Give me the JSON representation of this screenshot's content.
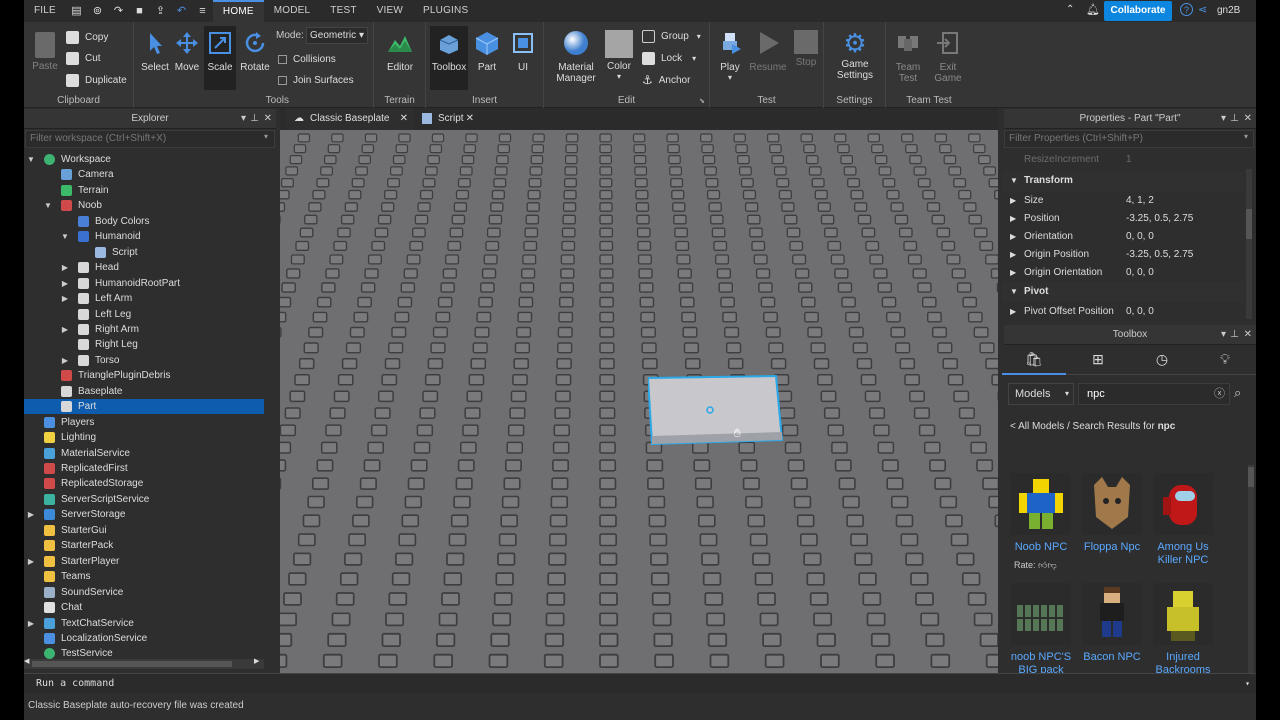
{
  "menu": {
    "file": "FILE",
    "tabs": [
      "HOME",
      "MODEL",
      "TEST",
      "VIEW",
      "PLUGINS"
    ],
    "collaborate": "Collaborate",
    "user": "gn2B"
  },
  "ribbon": {
    "clipboard": {
      "label": "Clipboard",
      "paste": "Paste",
      "copy": "Copy",
      "cut": "Cut",
      "duplicate": "Duplicate"
    },
    "tools": {
      "label": "Tools",
      "select": "Select",
      "move": "Move",
      "scale": "Scale",
      "rotate": "Rotate",
      "mode_label": "Mode:",
      "mode_value": "Geometric",
      "collisions": "Collisions",
      "join_surfaces": "Join Surfaces"
    },
    "terrain": {
      "label": "Terrain",
      "editor": "Editor"
    },
    "insert": {
      "label": "Insert",
      "toolbox": "Toolbox",
      "part": "Part",
      "ui": "UI"
    },
    "edit": {
      "label": "Edit",
      "material": "Material",
      "manager": "Manager",
      "color": "Color",
      "group": "Group",
      "lock": "Lock",
      "anchor": "Anchor"
    },
    "test": {
      "label": "Test",
      "play": "Play",
      "resume": "Resume",
      "stop": "Stop"
    },
    "settings": {
      "label": "Settings",
      "game": "Game",
      "settings": "Settings"
    },
    "team_test": {
      "label": "Team Test",
      "team": "Team",
      "test": "Test",
      "exit": "Exit",
      "game": "Game"
    }
  },
  "explorer": {
    "title": "Explorer",
    "filter_placeholder": "Filter workspace (Ctrl+Shift+X)",
    "items": [
      {
        "label": "Workspace",
        "indent": 0,
        "arrow": "▼",
        "color": "#3cb371",
        "round": true
      },
      {
        "label": "Camera",
        "indent": 1,
        "arrow": "",
        "color": "#6aa0d8"
      },
      {
        "label": "Terrain",
        "indent": 1,
        "arrow": "",
        "color": "#3cba6a"
      },
      {
        "label": "Noob",
        "indent": 1,
        "arrow": "▼",
        "color": "#d04a4a"
      },
      {
        "label": "Body Colors",
        "indent": 2,
        "arrow": "",
        "color": "#4a7fd8"
      },
      {
        "label": "Humanoid",
        "indent": 2,
        "arrow": "▼",
        "color": "#3b6fd0"
      },
      {
        "label": "Script",
        "indent": 3,
        "arrow": "",
        "color": "#9ab8e0"
      },
      {
        "label": "Head",
        "indent": 2,
        "arrow": "▶",
        "color": "#d8d8d8"
      },
      {
        "label": "HumanoidRootPart",
        "indent": 2,
        "arrow": "▶",
        "color": "#d8d8d8"
      },
      {
        "label": "Left Arm",
        "indent": 2,
        "arrow": "▶",
        "color": "#d8d8d8"
      },
      {
        "label": "Left Leg",
        "indent": 2,
        "arrow": "",
        "color": "#d8d8d8"
      },
      {
        "label": "Right Arm",
        "indent": 2,
        "arrow": "▶",
        "color": "#d8d8d8"
      },
      {
        "label": "Right Leg",
        "indent": 2,
        "arrow": "",
        "color": "#d8d8d8"
      },
      {
        "label": "Torso",
        "indent": 2,
        "arrow": "▶",
        "color": "#d8d8d8"
      },
      {
        "label": "TrianglePluginDebris",
        "indent": 1,
        "arrow": "",
        "color": "#d04a4a"
      },
      {
        "label": "Baseplate",
        "indent": 1,
        "arrow": "",
        "color": "#d8d8d8"
      },
      {
        "label": "Part",
        "indent": 1,
        "arrow": "",
        "color": "#d8d8d8",
        "selected": true
      },
      {
        "label": "Players",
        "indent": 0,
        "arrow": "",
        "color": "#4a8fe0"
      },
      {
        "label": "Lighting",
        "indent": 0,
        "arrow": "",
        "color": "#f0d040"
      },
      {
        "label": "MaterialService",
        "indent": 0,
        "arrow": "",
        "color": "#4aa0d8"
      },
      {
        "label": "ReplicatedFirst",
        "indent": 0,
        "arrow": "",
        "color": "#d04a4a"
      },
      {
        "label": "ReplicatedStorage",
        "indent": 0,
        "arrow": "",
        "color": "#d04a4a"
      },
      {
        "label": "ServerScriptService",
        "indent": 0,
        "arrow": "",
        "color": "#3cb3a0"
      },
      {
        "label": "ServerStorage",
        "indent": 0,
        "arrow": "▶",
        "color": "#3c8ad8"
      },
      {
        "label": "StarterGui",
        "indent": 0,
        "arrow": "",
        "color": "#f0c040"
      },
      {
        "label": "StarterPack",
        "indent": 0,
        "arrow": "",
        "color": "#f0c040"
      },
      {
        "label": "StarterPlayer",
        "indent": 0,
        "arrow": "▶",
        "color": "#f0c040"
      },
      {
        "label": "Teams",
        "indent": 0,
        "arrow": "",
        "color": "#f0c040"
      },
      {
        "label": "SoundService",
        "indent": 0,
        "arrow": "",
        "color": "#9ab0c8"
      },
      {
        "label": "Chat",
        "indent": 0,
        "arrow": "",
        "color": "#e0e0e0"
      },
      {
        "label": "TextChatService",
        "indent": 0,
        "arrow": "▶",
        "color": "#4aa0d8"
      },
      {
        "label": "LocalizationService",
        "indent": 0,
        "arrow": "",
        "color": "#4a8fe0"
      },
      {
        "label": "TestService",
        "indent": 0,
        "arrow": "",
        "color": "#3cb371",
        "round": true
      }
    ]
  },
  "doc_tabs": [
    "Classic Baseplate",
    "Script"
  ],
  "properties": {
    "title": "Properties - Part \"Part\"",
    "filter_placeholder": "Filter Properties (Ctrl+Shift+P)",
    "faded_row": "ResizeIncrement",
    "faded_value": "1",
    "sections": [
      {
        "name": "Transform",
        "rows": [
          {
            "name": "Size",
            "value": "4, 1, 2"
          },
          {
            "name": "Position",
            "value": "-3.25, 0.5, 2.75"
          },
          {
            "name": "Orientation",
            "value": "0, 0, 0"
          },
          {
            "name": "Origin Position",
            "value": "-3.25, 0.5, 2.75"
          },
          {
            "name": "Origin Orientation",
            "value": "0, 0, 0"
          }
        ]
      },
      {
        "name": "Pivot",
        "rows": [
          {
            "name": "Pivot Offset Position",
            "value": "0, 0, 0"
          }
        ]
      }
    ]
  },
  "toolbox": {
    "title": "Toolbox",
    "category": "Models",
    "search_value": "npc",
    "breadcrumb_prefix": "< All Models / Search Results for ",
    "breadcrumb_query": "npc",
    "rate_label": "Rate:",
    "items": [
      {
        "name": "Noob NPC"
      },
      {
        "name": "Floppa Npc"
      },
      {
        "name": "Among Us Killer NPC"
      },
      {
        "name": "noob NPC'S BIG pack"
      },
      {
        "name": "Bacon NPC"
      },
      {
        "name": "Injured Backrooms"
      }
    ]
  },
  "command_bar": {
    "placeholder": "Run a command"
  },
  "status": {
    "text": "Classic Baseplate auto-recovery file was created"
  },
  "colors": {
    "accent": "#0e5cad",
    "collaborate": "#0d86e0",
    "selection_outline": "#2aa8e8"
  }
}
